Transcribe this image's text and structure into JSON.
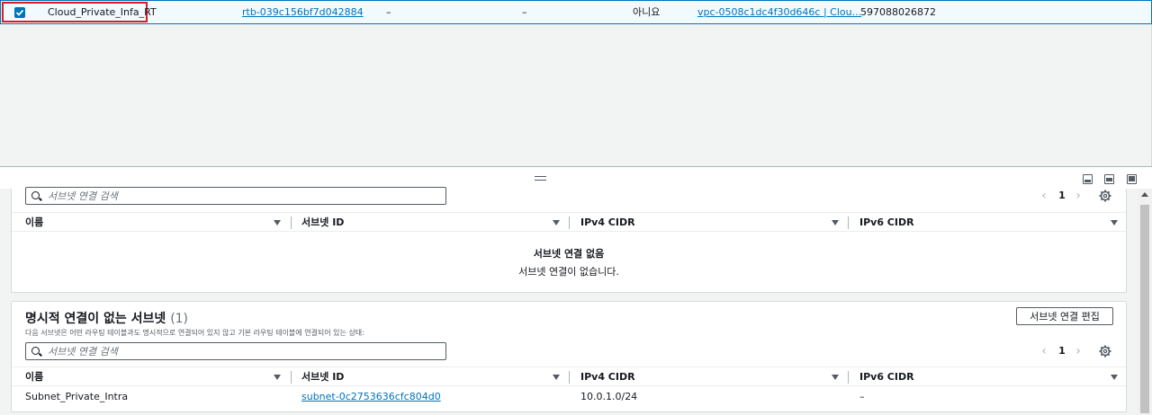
{
  "route_table_row": {
    "name": "Cloud_Private_Infa_RT",
    "route_table_id": "rtb-039c156bf7d042884",
    "col3": "–",
    "col4": "–",
    "main": "아니요",
    "vpc": "vpc-0508c1dc4f30d646c | Clou...",
    "owner": "597088026872",
    "selected": true
  },
  "explicit": {
    "search_placeholder": "서브넷 연결 검색",
    "page": "1",
    "columns": [
      "이름",
      "서브넷 ID",
      "IPv4 CIDR",
      "IPv6 CIDR"
    ],
    "empty_title": "서브넷 연결 없음",
    "empty_desc": "서브넷 연결이 없습니다."
  },
  "implicit": {
    "title": "명시적 연결이 없는 서브넷",
    "count": "(1)",
    "description": "다음 서브넷은 어떤 라우팅 테이블과도 명시적으로 연결되어 있지 않고 기본 라우팅 테이블에 연결되어 있는 상태:",
    "edit_button": "서브넷 연결 편집",
    "search_placeholder": "서브넷 연결 검색",
    "page": "1",
    "columns": [
      "이름",
      "서브넷 ID",
      "IPv4 CIDR",
      "IPv6 CIDR"
    ],
    "rows": [
      {
        "name": "Subnet_Private_Intra",
        "subnet_id": "subnet-0c2753636cfc804d0",
        "ipv4": "10.0.1.0/24",
        "ipv6": "–"
      }
    ]
  },
  "colors": {
    "accent": "#0073bb",
    "highlight": "#d91c25"
  }
}
